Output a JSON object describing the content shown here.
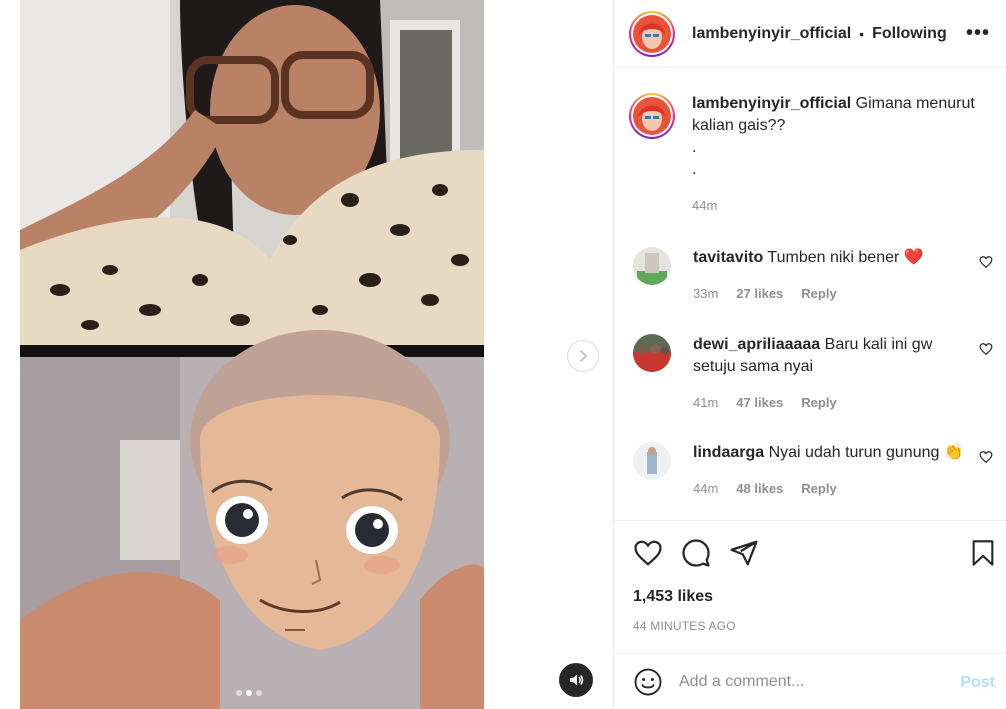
{
  "colors": {
    "accent": "#0095f6",
    "post_disabled": "#b2dffc",
    "muted": "#8e8e8e",
    "heart_red": "#ed4956"
  },
  "header": {
    "username": "lambenyinyir_official",
    "separator": "•",
    "follow_label": "Following",
    "more_icon": "more-horizontal-icon"
  },
  "caption": {
    "username": "lambenyinyir_official",
    "text": "Gimana menurut kalian gais??",
    "line2": ".",
    "line3": ".",
    "time": "44m"
  },
  "comments": [
    {
      "username": "tavitavito",
      "text": "Tumben niki bener",
      "emoji": "❤️",
      "time": "33m",
      "likes": "27 likes",
      "reply": "Reply"
    },
    {
      "username": "dewi_apriliaaaaa",
      "text": "Baru kali ini gw setuju sama nyai",
      "emoji": "",
      "time": "41m",
      "likes": "47 likes",
      "reply": "Reply"
    },
    {
      "username": "lindaarga",
      "text": "Nyai udah turun gunung",
      "emoji": "👏",
      "time": "44m",
      "likes": "48 likes",
      "reply": "Reply"
    }
  ],
  "actions": {
    "likes": "1,453 likes",
    "time_ago": "44 MINUTES AGO"
  },
  "add_comment": {
    "placeholder": "Add a comment...",
    "post_label": "Post"
  },
  "carousel": {
    "total": 3,
    "active": 2
  }
}
